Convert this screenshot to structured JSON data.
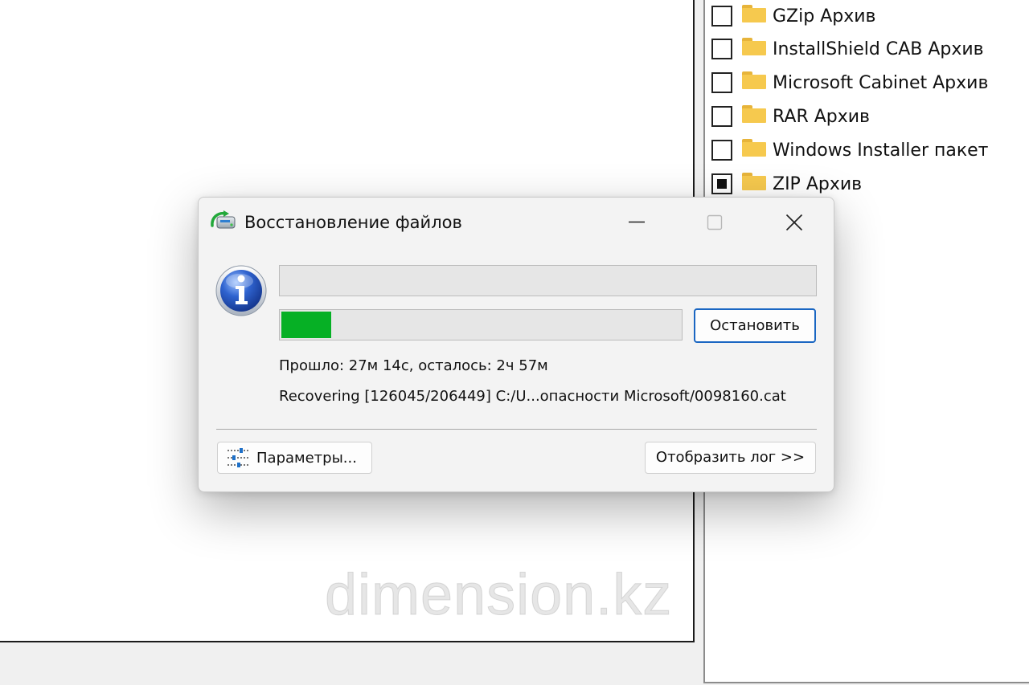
{
  "file_types": [
    {
      "label": "GZip Архив",
      "checked": false
    },
    {
      "label": "InstallShield CAB Архив",
      "checked": false
    },
    {
      "label": "Microsoft Cabinet Архив",
      "checked": false
    },
    {
      "label": "RAR Архив",
      "checked": false
    },
    {
      "label": "Windows Installer пакет",
      "checked": false
    },
    {
      "label": "ZIP Архив",
      "checked": true
    }
  ],
  "dialog": {
    "title": "Восстановление файлов",
    "icons": {
      "app": "recovery-app-icon",
      "info": "info-icon",
      "minimize": "minimize-icon",
      "maximize": "maximize-icon",
      "close": "close-icon",
      "params": "settings-sliders-icon"
    },
    "progress": {
      "top_fraction": 0,
      "main_fraction": 0.126,
      "fill_color": "#06b025"
    },
    "stop_label": "Остановить",
    "elapsed_text": "Прошло: 27м 14с, осталось: 2ч 57м",
    "recover_text": "Recovering [126045/206449] C:/U...опасности Microsoft/0098160.cat",
    "params_label": "Параметры...",
    "log_label": "Отобразить лог >>"
  },
  "watermark": "dimension.kz"
}
